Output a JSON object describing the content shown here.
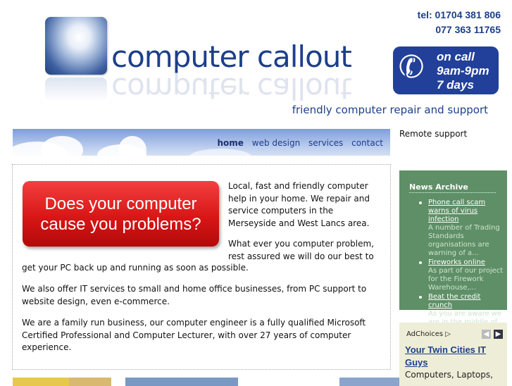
{
  "header": {
    "logo_text": "computer callout",
    "tel_line1": "tel: 01704 381 806",
    "tel_line2": "077 363 11765",
    "oncall": [
      "on call",
      "9am-9pm",
      "7 days"
    ],
    "tagline": "friendly computer repair and support"
  },
  "nav": {
    "items": [
      {
        "label": "home",
        "active": true
      },
      {
        "label": "web design",
        "active": false
      },
      {
        "label": "services",
        "active": false
      },
      {
        "label": "contact",
        "active": false
      }
    ]
  },
  "main": {
    "promo_banner": "Does your computer cause you problems?",
    "p1": "Local, fast and friendly computer help in your home. We repair and service computers in the Merseyside and West Lancs area.",
    "p2a": "What ever you computer problem, rest assured we will do our best to",
    "p2b": "get your PC back up and running as soon as possible.",
    "p3": "We also offer IT services to small and home office businesses, from PC support to website design, even e-commerce.",
    "p4": "We are a family run business, our computer engineer is a fully qualified Microsoft Certified Professional and Computer Lecturer, with over 27 years of computer experience."
  },
  "sidebar": {
    "remote_support": "Remote support",
    "news": {
      "title": "News Archive",
      "items": [
        {
          "title": "Phone call scam warns of virus infection",
          "excerpt": "A number of Trading Standards organisations are warning of a..."
        },
        {
          "title": "Fireworks online",
          "excerpt": "As part of our project for the Firework Warehouse,..."
        },
        {
          "title": "Beat the credit crunch",
          "excerpt": "As you are aware we are in the middle of..."
        }
      ]
    },
    "ads": {
      "adchoices": "AdChoices",
      "title": "Your Twin Cities IT Guys",
      "body": "Computers, Laptops,"
    }
  }
}
